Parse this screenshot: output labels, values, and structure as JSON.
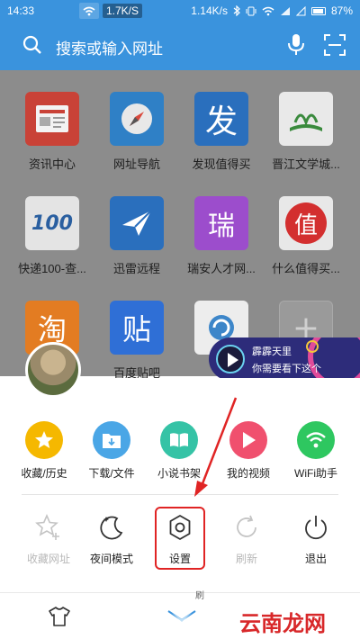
{
  "statusbar": {
    "time": "14:33",
    "speed_badge": "1.7K/S",
    "speed_right": "1.14K/s",
    "battery": "87%"
  },
  "search": {
    "placeholder": "搜索或输入网址",
    "search_icon": "search-icon",
    "mic_icon": "mic-icon",
    "scan_icon": "scan-icon"
  },
  "tiles": [
    {
      "label": "资讯中心",
      "icon": "news-icon",
      "color": "#d9483b"
    },
    {
      "label": "网址导航",
      "icon": "compass-icon",
      "color": "#2f80c6"
    },
    {
      "label": "发现值得买",
      "icon": "fa-char-icon",
      "color": "#2a6fbd"
    },
    {
      "label": "晋江文学城...",
      "icon": "book-icon",
      "color": "#3a8a3d"
    },
    {
      "label": "快递100-查...",
      "icon": "100-icon",
      "color": "#d9d9d9"
    },
    {
      "label": "迅雷远程",
      "icon": "bird-icon",
      "color": "#2a6fbd"
    },
    {
      "label": "瑞安人才网...",
      "icon": "rui-char-icon",
      "color": "#9c4dcc"
    },
    {
      "label": "什么值得买...",
      "icon": "zhi-char-icon",
      "color": "#d32f2f"
    },
    {
      "label": "",
      "icon": "tao-char-icon",
      "color": "#e37c22"
    },
    {
      "label": "百度贴吧",
      "icon": "tie-char-icon",
      "color": "#2f6fd6"
    },
    {
      "label": "",
      "icon": "refresh-app-icon",
      "color": "#3d86c9"
    },
    {
      "label": "",
      "icon": "plus-icon",
      "color": "#a7a7a7"
    }
  ],
  "tile_chars": {
    "fa": "发",
    "rui": "瑞",
    "zhi": "值",
    "tao": "淘",
    "tie": "贴",
    "k100": "100",
    "plus": "+"
  },
  "banner": {
    "line1": "霹霹天里",
    "line2": "你需要看下这个"
  },
  "menu": [
    {
      "label": "收藏/历史",
      "icon": "star-icon",
      "color": "#f5b800"
    },
    {
      "label": "下载/文件",
      "icon": "download-icon",
      "color": "#4aa6e6"
    },
    {
      "label": "小说书架",
      "icon": "book-open-icon",
      "color": "#35c3a6"
    },
    {
      "label": "我的视频",
      "icon": "play-icon",
      "color": "#f0506e"
    },
    {
      "label": "WiFi助手",
      "icon": "wifi-icon",
      "color": "#2ec760"
    }
  ],
  "tools": [
    {
      "label": "收藏网址",
      "icon": "star-add-icon",
      "disabled": true
    },
    {
      "label": "夜间模式",
      "icon": "moon-icon",
      "disabled": false
    },
    {
      "label": "设置",
      "icon": "gear-icon",
      "disabled": false
    },
    {
      "label": "刷新",
      "icon": "refresh-icon",
      "disabled": true
    },
    {
      "label": "退出",
      "icon": "power-icon",
      "disabled": false
    }
  ],
  "bottombar": {
    "tshirt_icon": "tshirt-icon",
    "sheet_icon": "sheet-close-icon",
    "partial_label": "刷",
    "watermark": "云南龙网"
  },
  "colors": {
    "primary": "#3a93dd",
    "highlight": "#e02424"
  }
}
